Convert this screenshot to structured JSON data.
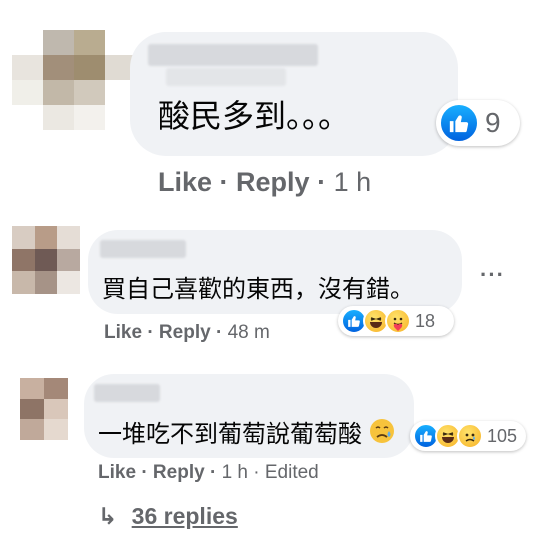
{
  "comments": [
    {
      "text": "酸民多到。。。",
      "reaction_count": "9",
      "reactions": [
        "like-icon"
      ],
      "actions": {
        "like": "Like",
        "reply": "Reply",
        "time": "1 h"
      }
    },
    {
      "text": "買自己喜歡的東西，沒有錯。",
      "reaction_count": "18",
      "reactions": [
        "like-icon",
        "haha-icon",
        "care-icon"
      ],
      "actions": {
        "like": "Like",
        "reply": "Reply",
        "time": "48 m"
      }
    },
    {
      "text": "一堆吃不到葡萄說葡萄酸",
      "emoji": "sad-face-emoji",
      "reaction_count": "105",
      "reactions": [
        "like-icon",
        "haha-icon",
        "sad-icon"
      ],
      "actions": {
        "like": "Like",
        "reply": "Reply",
        "time": "1 h",
        "edited": "Edited"
      }
    }
  ],
  "view_replies": {
    "arrow": "↳",
    "label": "36 replies"
  },
  "colors": {
    "bubble": "#f0f2f5",
    "secondary_text": "#65676b",
    "like_blue": "#1877f2"
  }
}
